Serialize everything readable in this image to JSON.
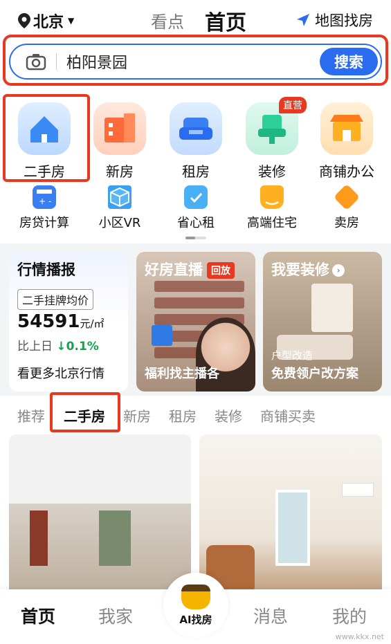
{
  "header": {
    "city": "北京",
    "tab_kandian": "看点",
    "tab_home": "首页",
    "map_find": "地图找房"
  },
  "search": {
    "query": "柏阳景园",
    "button": "搜索"
  },
  "big_icons": [
    {
      "label": "二手房",
      "color": "#3a8bf5"
    },
    {
      "label": "新房",
      "color": "#ff6a3a"
    },
    {
      "label": "租房",
      "color": "#3b7ff2"
    },
    {
      "label": "装修",
      "color": "#2fcf9a",
      "badge": "直营"
    },
    {
      "label": "商铺办公",
      "color": "#ff9a1a"
    }
  ],
  "small_icons": [
    {
      "label": "房贷计算",
      "color": "#3a7ff2"
    },
    {
      "label": "小区VR",
      "color": "#3aa0f0"
    },
    {
      "label": "省心租",
      "color": "#4ab0f5"
    },
    {
      "label": "高端住宅",
      "color": "#ffb020"
    },
    {
      "label": "卖房",
      "color": "#ff9a1a"
    }
  ],
  "cards": {
    "market": {
      "title": "行情播报",
      "price_label": "二手挂牌均价",
      "price": "54591",
      "unit": "元/㎡",
      "change_prefix": "比上日",
      "change_arrow": "↓",
      "change_pct": "0.1%",
      "bottom": "看更多北京行情"
    },
    "live": {
      "title": "好房直播",
      "replay": "回放",
      "bottom": "福利找主播各"
    },
    "reno": {
      "title": "我要装修",
      "sub": "户型改造",
      "bottom": "免费领户改方案"
    }
  },
  "feed_tabs": [
    "推荐",
    "二手房",
    "新房",
    "租房",
    "装修",
    "商铺买卖"
  ],
  "bottom_nav": {
    "home": "首页",
    "mine": "我家",
    "ai": "AI找房",
    "messages": "消息",
    "me": "我的"
  },
  "watermark": "www.kkx.net"
}
